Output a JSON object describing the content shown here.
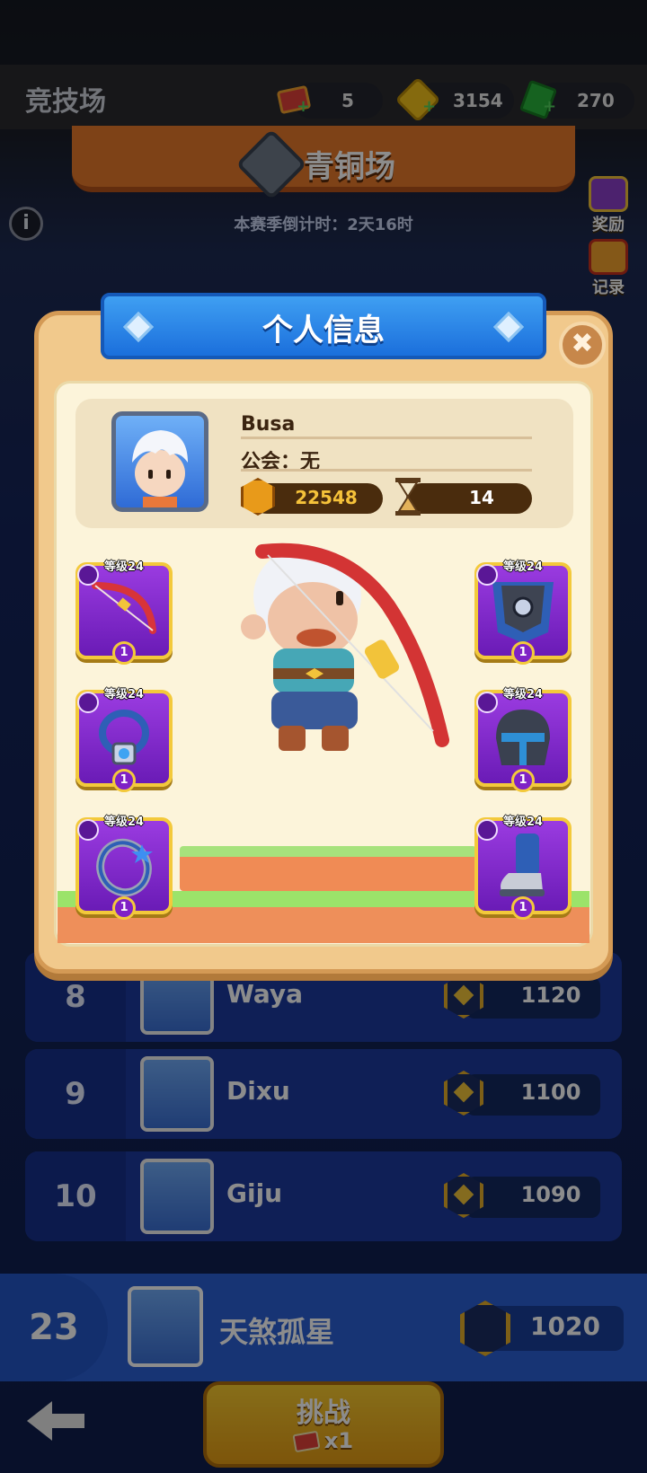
{
  "header": {
    "title": "竞技场",
    "tickets": "5",
    "coins": "3154",
    "gems": "270"
  },
  "arena": {
    "name": "青铜场",
    "countdown": "本赛季倒计时：2天16时"
  },
  "side_buttons": [
    {
      "label": "奖励",
      "icon": "gift-icon"
    },
    {
      "label": "记录",
      "icon": "trophy-icon"
    }
  ],
  "leaderboard": [
    {
      "rank": "8",
      "name": "Waya",
      "score": "1120"
    },
    {
      "rank": "9",
      "name": "Dixu",
      "score": "1100"
    },
    {
      "rank": "10",
      "name": "Giju",
      "score": "1090"
    }
  ],
  "me": {
    "rank": "23",
    "name": "天煞孤星",
    "score": "1020"
  },
  "challenge": {
    "label": "挑战",
    "cost": "x1"
  },
  "modal": {
    "title": "个人信息",
    "player_name": "Busa",
    "guild": "公会：无",
    "power": "22548",
    "hourglass_value": "14",
    "equipment": [
      {
        "slot": "weapon",
        "level_label": "等级24",
        "stars": "1",
        "icon": "bow-icon"
      },
      {
        "slot": "armor",
        "level_label": "等级24",
        "stars": "1",
        "icon": "cloak-armor-icon"
      },
      {
        "slot": "necklace",
        "level_label": "等级24",
        "stars": "1",
        "icon": "amulet-icon"
      },
      {
        "slot": "helmet",
        "level_label": "等级24",
        "stars": "1",
        "icon": "helmet-icon"
      },
      {
        "slot": "ring",
        "level_label": "等级24",
        "stars": "1",
        "icon": "ring-icon"
      },
      {
        "slot": "boots",
        "level_label": "等级24",
        "stars": "1",
        "icon": "boots-icon"
      }
    ]
  },
  "colors": {
    "modal_bg": "#f1c98c",
    "header_blue": "#2a86e8",
    "equip_purple": "#7a24c8",
    "equip_border": "#f3c93b"
  }
}
